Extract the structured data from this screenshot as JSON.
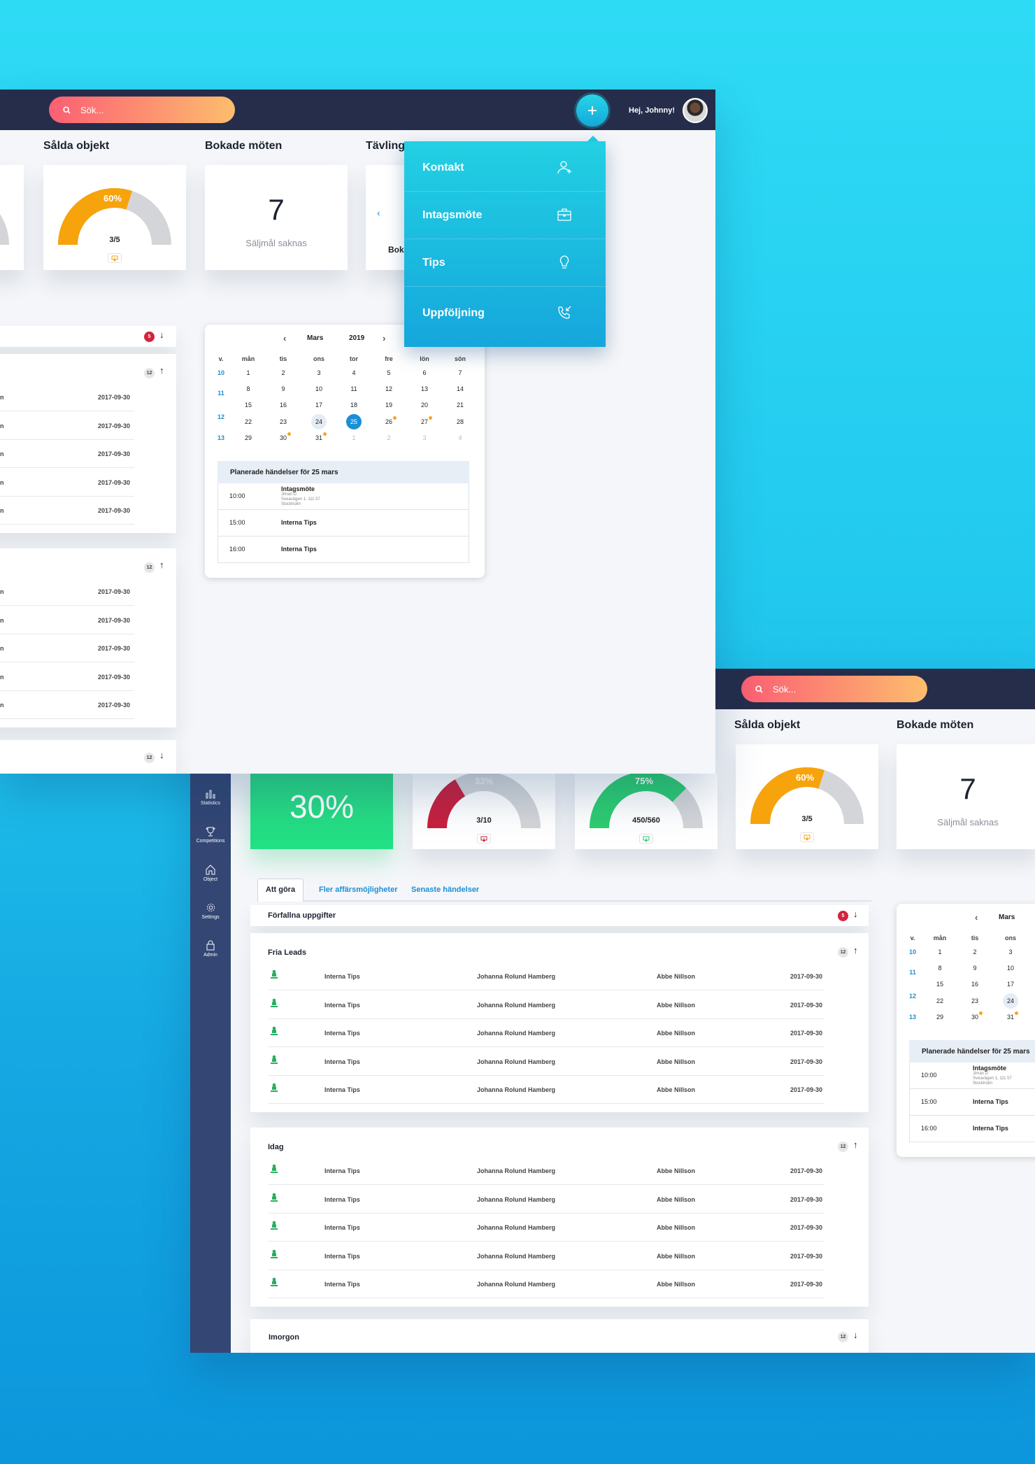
{
  "search_placeholder": "Sök...",
  "greeting": "Hej, Johnny!",
  "sections": {
    "sold": "Sålda objekt",
    "meetings": "Bokade möten",
    "competition": "Tävling"
  },
  "sold_gauge": {
    "pct_label": "60%",
    "count": "3/5",
    "fraction": 0.6,
    "color": "#f7a30c"
  },
  "meetings_card": {
    "number": "7",
    "subtitle": "Säljmål saknas"
  },
  "competition_partial": {
    "text": "Boka"
  },
  "add_menu": {
    "items": [
      {
        "label": "Kontakt",
        "icon": "add-contact-icon"
      },
      {
        "label": "Intagsmöte",
        "icon": "briefcase-icon"
      },
      {
        "label": "Tips",
        "icon": "lightbulb-icon"
      },
      {
        "label": "Uppföljning",
        "icon": "callback-phone-icon"
      }
    ]
  },
  "calendar": {
    "month": "Mars",
    "year": "2019",
    "week_label": "v.",
    "days": [
      "mån",
      "tis",
      "ons",
      "tor",
      "fre",
      "lön",
      "sön"
    ],
    "weeks": [
      {
        "w": "10",
        "d": [
          "1",
          "2",
          "3",
          "4",
          "5",
          "6",
          "7"
        ]
      },
      {
        "w": "11",
        "d": [
          "8",
          "9",
          "10",
          "11",
          "12",
          "13",
          "14"
        ]
      },
      {
        "w": "",
        "d": [
          "15",
          "16",
          "17",
          "18",
          "19",
          "20",
          "21"
        ]
      },
      {
        "w": "12",
        "d": [
          "22",
          "23",
          "24",
          "25",
          "26",
          "27",
          "28"
        ]
      },
      {
        "w": "13",
        "d": [
          "29",
          "30",
          "31",
          "1",
          "2",
          "3",
          "4"
        ]
      }
    ],
    "events_title": "Planerade händelser för 25 mars",
    "events": [
      {
        "time": "10:00",
        "title": "Intagsmöte",
        "line1": "Jiman D",
        "line2": "Sveavägen 1, 111 57",
        "line3": "Stockholm"
      },
      {
        "time": "15:00",
        "title": "Interna Tips"
      },
      {
        "time": "16:00",
        "title": "Interna Tips"
      }
    ]
  },
  "lists": {
    "overdue": {
      "title": "Förfallna uppgifter",
      "count": "5"
    },
    "fria": {
      "title": "Fria Leads",
      "count": "12"
    },
    "idag": {
      "title": "Idag",
      "count": "12"
    },
    "imorgon": {
      "title": "Imorgon",
      "count": "12"
    },
    "row": {
      "type": "Interna Tips",
      "owner": "Johanna Rolund Hamberg",
      "agent": "Abbe Nillson",
      "date": "2017-09-30"
    }
  },
  "tabs": [
    "Att göra",
    "Fler affärsmöjligheter",
    "Senaste händelser"
  ],
  "sidebar": [
    {
      "label": "Statistics",
      "icon": "bar-chart-icon"
    },
    {
      "label": "Competitions",
      "icon": "trophy-icon"
    },
    {
      "label": "Object",
      "icon": "home-icon"
    },
    {
      "label": "Settings",
      "icon": "gear-icon"
    },
    {
      "label": "Admin",
      "icon": "lock-icon"
    }
  ],
  "stats": {
    "green_pct": "30%",
    "red_gauge": {
      "pct_label": "33%",
      "count": "3/10",
      "fraction": 0.33,
      "color": "#c8203e"
    },
    "green_gauge": {
      "pct_label": "75%",
      "count": "450/560",
      "fraction": 0.75,
      "color": "#2ecc71"
    }
  }
}
